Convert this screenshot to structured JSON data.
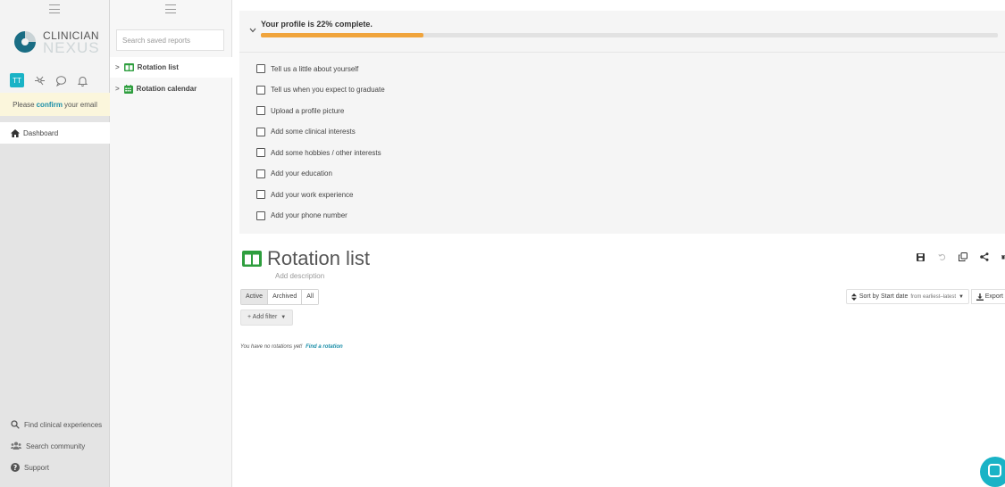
{
  "nav": {
    "logo_line1": "CLINICIAN",
    "logo_line2": "NEXUS",
    "avatar_initials": "TT",
    "confirm_prefix": "Please",
    "confirm_link": "confirm",
    "confirm_suffix": "your email",
    "dashboard": "Dashboard",
    "bottom": [
      {
        "label": "Find clinical experiences",
        "icon": "search-icon"
      },
      {
        "label": "Search community",
        "icon": "community-icon"
      },
      {
        "label": "Support",
        "icon": "help-icon"
      }
    ]
  },
  "reports": {
    "search_placeholder": "Search saved reports",
    "items": [
      {
        "label": "Rotation list",
        "icon": "table-icon"
      },
      {
        "label": "Rotation calendar",
        "icon": "calendar-icon"
      }
    ]
  },
  "profile": {
    "title": "Your profile is 22% complete.",
    "progress": 0.22,
    "tasks": [
      "Tell us a little about yourself",
      "Tell us when you expect to graduate",
      "Upload a profile picture",
      "Add some clinical interests",
      "Add some hobbies / other interests",
      "Add your education",
      "Add your work experience",
      "Add your phone number"
    ]
  },
  "report": {
    "title": "Rotation list",
    "description": "Add description",
    "tabs": [
      "Active",
      "Archived",
      "All"
    ],
    "filter_label": "+ Add filter",
    "sort_label": "Sort by Start date",
    "sort_detail": "from earliest–latest",
    "export_label": "Export",
    "empty_text": "You have no rotations yet!",
    "empty_link": "Find a rotation"
  },
  "colors": {
    "accent": "#19b3c6",
    "progress": "#f0a43c",
    "rotation_green": "#2e9e3e"
  }
}
